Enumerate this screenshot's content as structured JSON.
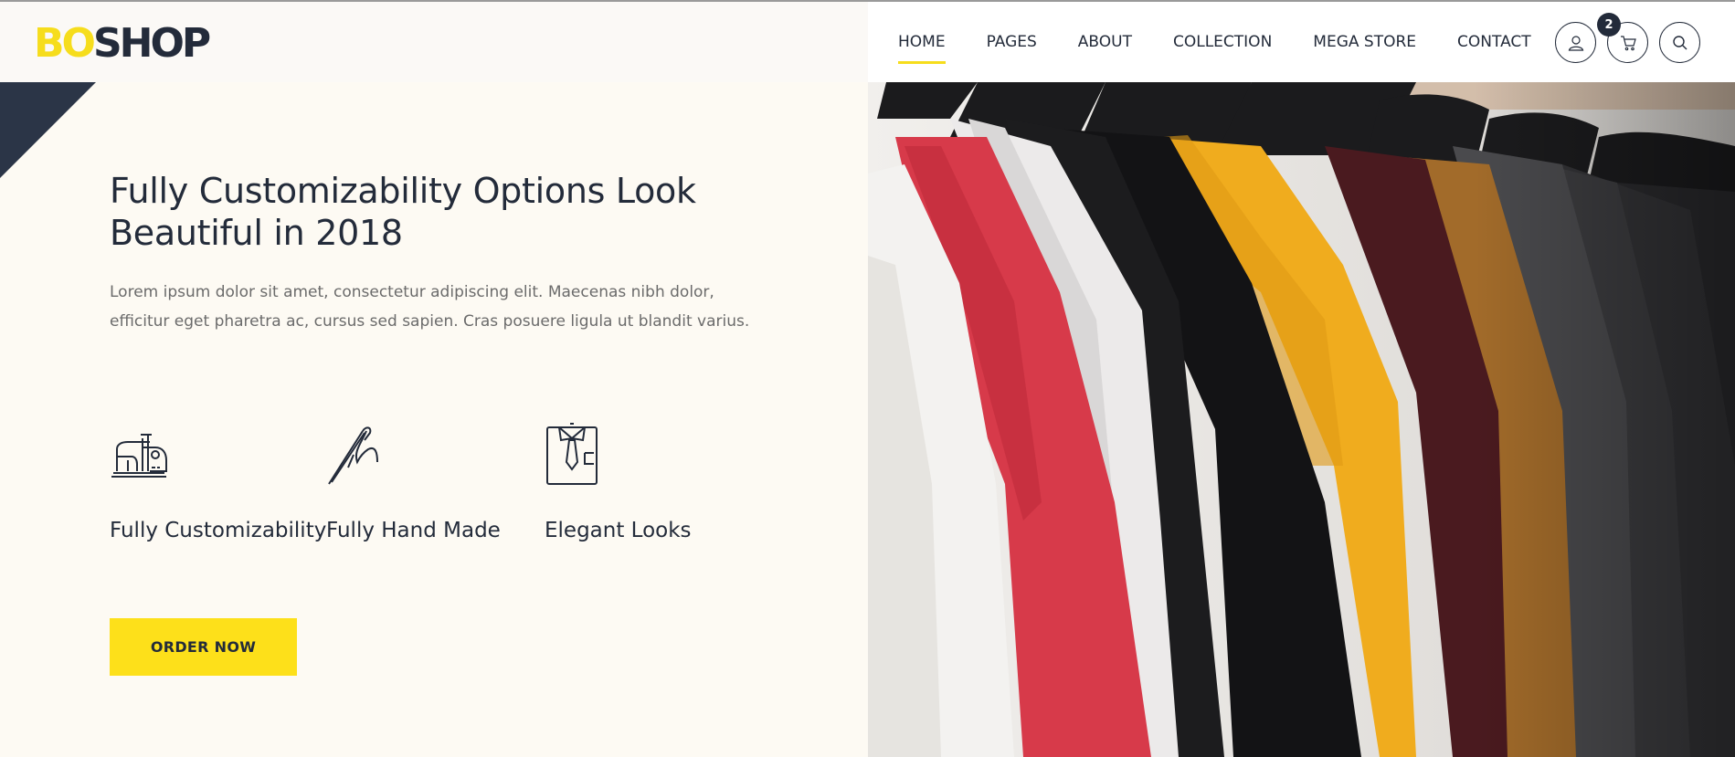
{
  "brand": {
    "part1": "BO",
    "part2": "SHOP",
    "accent_color": "#f6dd1c",
    "dark_color": "#232b3a"
  },
  "nav": {
    "items": [
      {
        "label": "HOME",
        "active": true
      },
      {
        "label": "PAGES",
        "active": false
      },
      {
        "label": "ABOUT",
        "active": false
      },
      {
        "label": "COLLECTION",
        "active": false
      },
      {
        "label": "MEGA STORE",
        "active": false
      },
      {
        "label": "CONTACT",
        "active": false
      }
    ]
  },
  "header_actions": {
    "account_icon": "user-icon",
    "cart_icon": "cart-icon",
    "cart_count": "2",
    "search_icon": "search-icon"
  },
  "hero": {
    "title": "Fully Customizability Options Look Beautiful in 2018",
    "description": "Lorem ipsum dolor sit amet, consectetur adipiscing elit. Maecenas nibh dolor, efficitur eget pharetra ac, cursus sed sapien. Cras posuere ligula ut blandit varius.",
    "features": [
      {
        "icon": "sewing-machine-icon",
        "label": "Fully Customizability"
      },
      {
        "icon": "needle-thread-icon",
        "label": "Fully Hand Made"
      },
      {
        "icon": "shirt-tie-icon",
        "label": "Elegant Looks"
      }
    ],
    "cta_label": "ORDER NOW",
    "image": "shirts-on-hangers"
  }
}
